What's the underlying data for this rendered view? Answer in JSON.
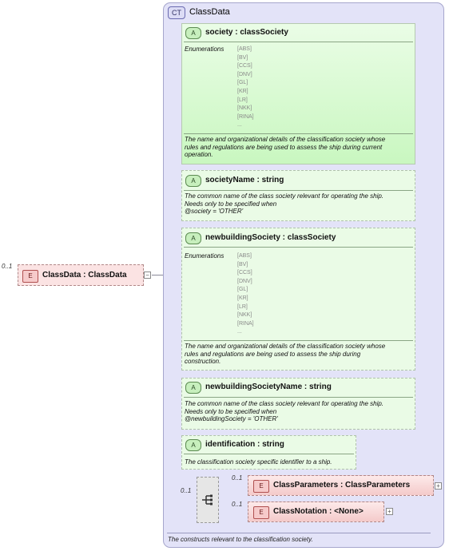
{
  "complex_type": {
    "badge": "CT",
    "name": "ClassData",
    "description": "The constructs relevant to the classification society."
  },
  "root_element": {
    "occurrence": "0..1",
    "badge": "E",
    "title": "ClassData  : ClassData",
    "toggle": "−"
  },
  "attributes": [
    {
      "badge": "A",
      "title": "society    : classSociety",
      "enumerations_label": "Enumerations",
      "enumerations": "[ABS]\n[BV]\n[CCS]\n[DNV]\n[GL]\n[KR]\n[LR]\n[NKK]\n[RINA]\n...",
      "doc": [
        "The name and organizational details of the classification society whose",
        "rules and regulations are being used to assess the ship during current",
        "operation."
      ]
    },
    {
      "badge": "A",
      "title": "societyName  : string",
      "doc": [
        "The common name of the class society relevant for operating the ship.",
        "Needs only to be specified when",
        "@society = 'OTHER'"
      ]
    },
    {
      "badge": "A",
      "title": "newbuildingSociety  : classSociety",
      "enumerations_label": "Enumerations",
      "enumerations": "[ABS]\n[BV]\n[CCS]\n[DNV]\n[GL]\n[KR]\n[LR]\n[NKK]\n[RINA]\n...",
      "doc": [
        "The name and organizational details of the classification society whose",
        "rules and regulations are being used to assess the ship during",
        "construction."
      ]
    },
    {
      "badge": "A",
      "title": "newbuildingSocietyName  : string",
      "doc": [
        "The common name of the class society relevant for operating the ship.",
        "Needs only to be specified when",
        "@newbuildingSociety = 'OTHER'"
      ]
    },
    {
      "badge": "A",
      "title": "identification  : string",
      "doc": [
        "The classification society specific identifier to a ship."
      ]
    }
  ],
  "sequence": {
    "occurrence": "0..1",
    "icon": "sequence-compositor-icon"
  },
  "child_elements": [
    {
      "occurrence": "0..1",
      "badge": "E",
      "title": "ClassParameters  : ClassParameters",
      "toggle": "+"
    },
    {
      "occurrence": "0..1",
      "badge": "E",
      "title": "ClassNotation  : <None>",
      "toggle": "+"
    }
  ]
}
